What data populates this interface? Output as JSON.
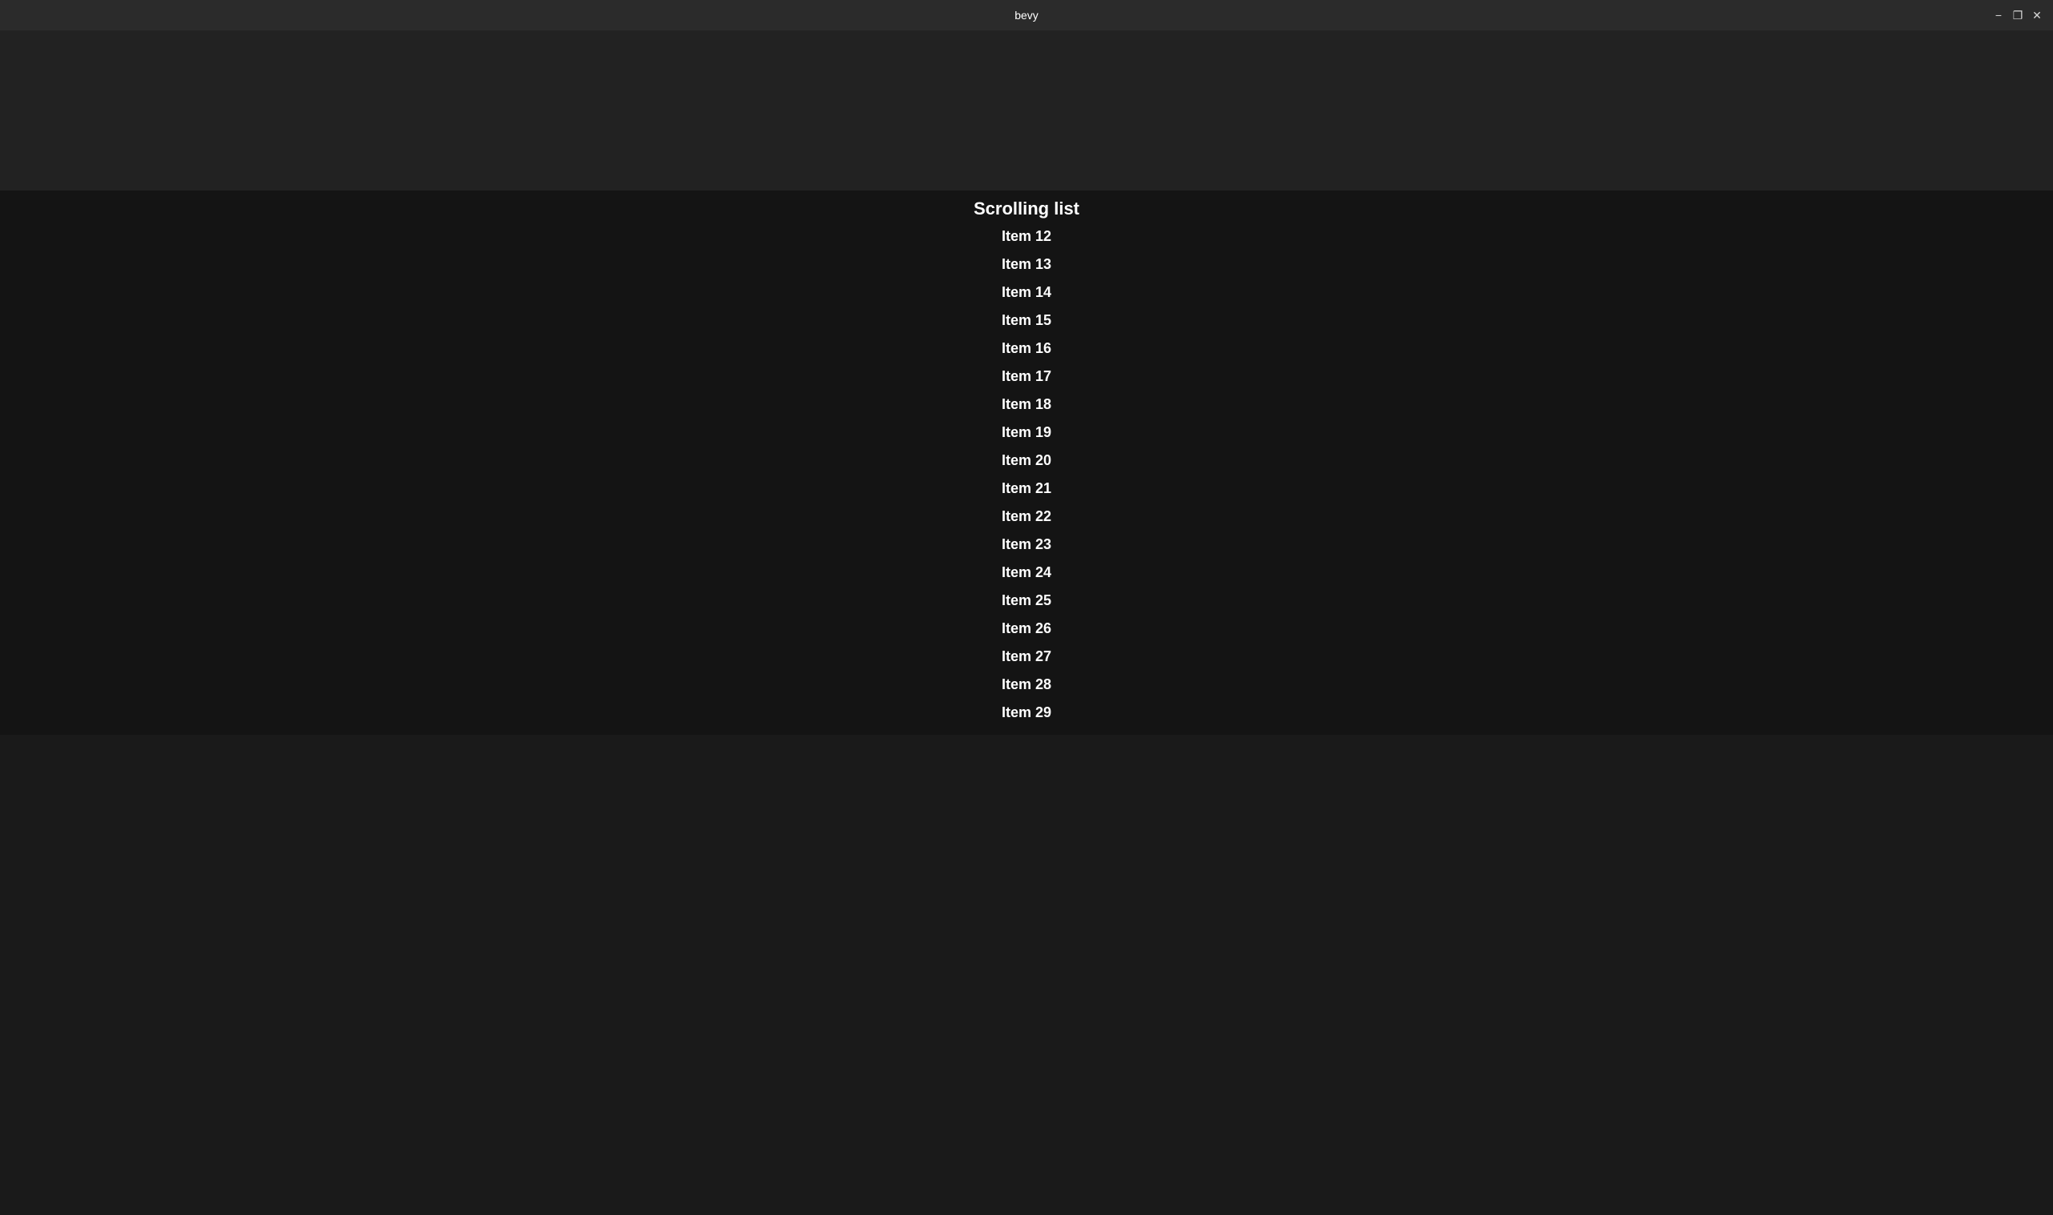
{
  "titlebar": {
    "title": "bevy",
    "minimize_label": "−",
    "maximize_label": "❐",
    "close_label": "✕"
  },
  "main": {
    "section_title": "Scrolling list",
    "items": [
      {
        "label": "Item 12"
      },
      {
        "label": "Item 13"
      },
      {
        "label": "Item 14"
      },
      {
        "label": "Item 15"
      },
      {
        "label": "Item 16"
      },
      {
        "label": "Item 17"
      },
      {
        "label": "Item 18"
      },
      {
        "label": "Item 19"
      },
      {
        "label": "Item 20"
      },
      {
        "label": "Item 21"
      },
      {
        "label": "Item 22"
      },
      {
        "label": "Item 23"
      },
      {
        "label": "Item 24"
      },
      {
        "label": "Item 25"
      },
      {
        "label": "Item 26"
      },
      {
        "label": "Item 27"
      },
      {
        "label": "Item 28"
      },
      {
        "label": "Item 29"
      }
    ]
  }
}
